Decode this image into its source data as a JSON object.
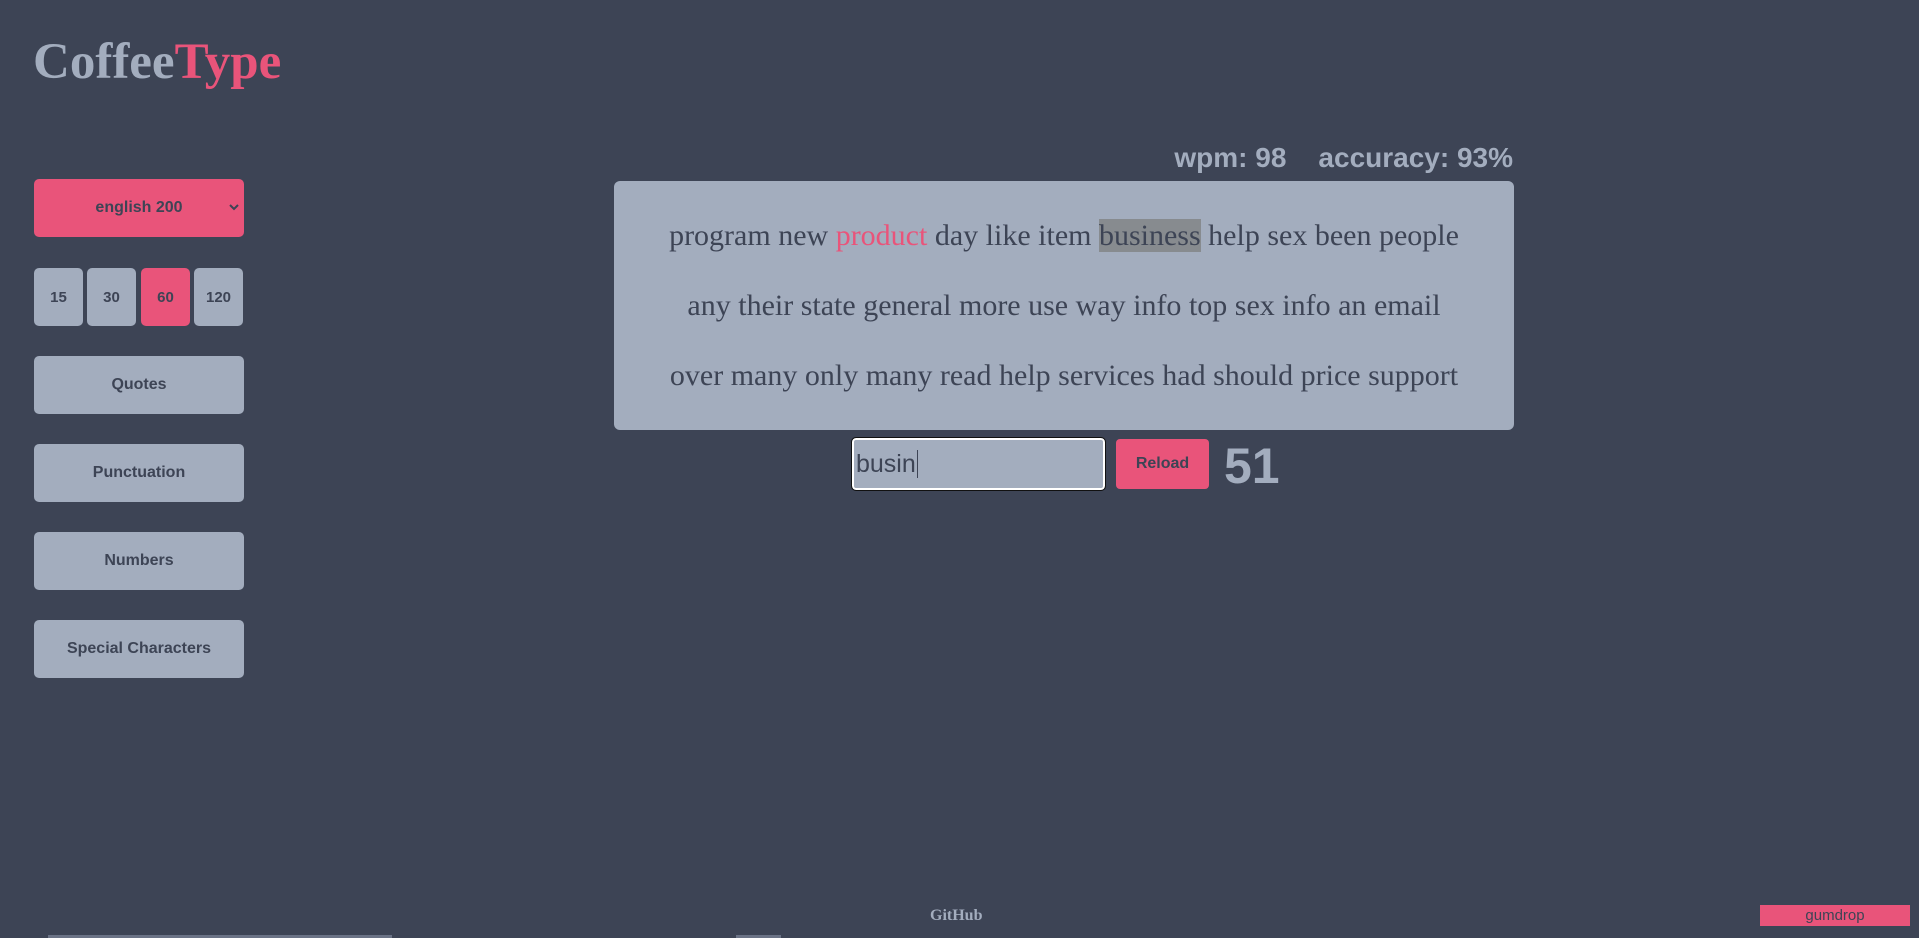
{
  "logo": {
    "part1": "Coffee",
    "part2": "Type"
  },
  "sidebar": {
    "language": "english 200",
    "durations": [
      "15",
      "30",
      "60",
      "120"
    ],
    "active_duration": "60",
    "quotes": "Quotes",
    "punctuation": "Punctuation",
    "numbers": "Numbers",
    "special": "Special Characters"
  },
  "stats": {
    "wpm": "wpm: 98",
    "accuracy": "accuracy: 93%"
  },
  "words": {
    "lines": [
      [
        {
          "t": "program",
          "s": ""
        },
        {
          "t": "new",
          "s": ""
        },
        {
          "t": "product",
          "s": "wrong"
        },
        {
          "t": "day",
          "s": ""
        },
        {
          "t": "like",
          "s": ""
        },
        {
          "t": "item",
          "s": ""
        },
        {
          "t": "business",
          "s": "current"
        },
        {
          "t": "help",
          "s": ""
        },
        {
          "t": "sex",
          "s": ""
        },
        {
          "t": "been",
          "s": ""
        },
        {
          "t": "people",
          "s": ""
        }
      ],
      [
        {
          "t": "any",
          "s": ""
        },
        {
          "t": "their",
          "s": ""
        },
        {
          "t": "state",
          "s": ""
        },
        {
          "t": "general",
          "s": ""
        },
        {
          "t": "more",
          "s": ""
        },
        {
          "t": "use",
          "s": ""
        },
        {
          "t": "way",
          "s": ""
        },
        {
          "t": "info",
          "s": ""
        },
        {
          "t": "top",
          "s": ""
        },
        {
          "t": "sex",
          "s": ""
        },
        {
          "t": "info",
          "s": ""
        },
        {
          "t": "an",
          "s": ""
        },
        {
          "t": "email",
          "s": ""
        }
      ],
      [
        {
          "t": "over",
          "s": ""
        },
        {
          "t": "many",
          "s": ""
        },
        {
          "t": "only",
          "s": ""
        },
        {
          "t": "many",
          "s": ""
        },
        {
          "t": "read",
          "s": ""
        },
        {
          "t": "help",
          "s": ""
        },
        {
          "t": "services",
          "s": ""
        },
        {
          "t": "had",
          "s": ""
        },
        {
          "t": "should",
          "s": ""
        },
        {
          "t": "price",
          "s": ""
        },
        {
          "t": "support",
          "s": ""
        }
      ]
    ]
  },
  "input": {
    "value": "busin"
  },
  "reload": "Reload",
  "timer": "51",
  "footer": {
    "github": "GitHub",
    "gumdrop": "gumdrop"
  },
  "colors": {
    "background": "#3d4455",
    "accent": "#e9547a",
    "muted": "#a3adbe"
  }
}
